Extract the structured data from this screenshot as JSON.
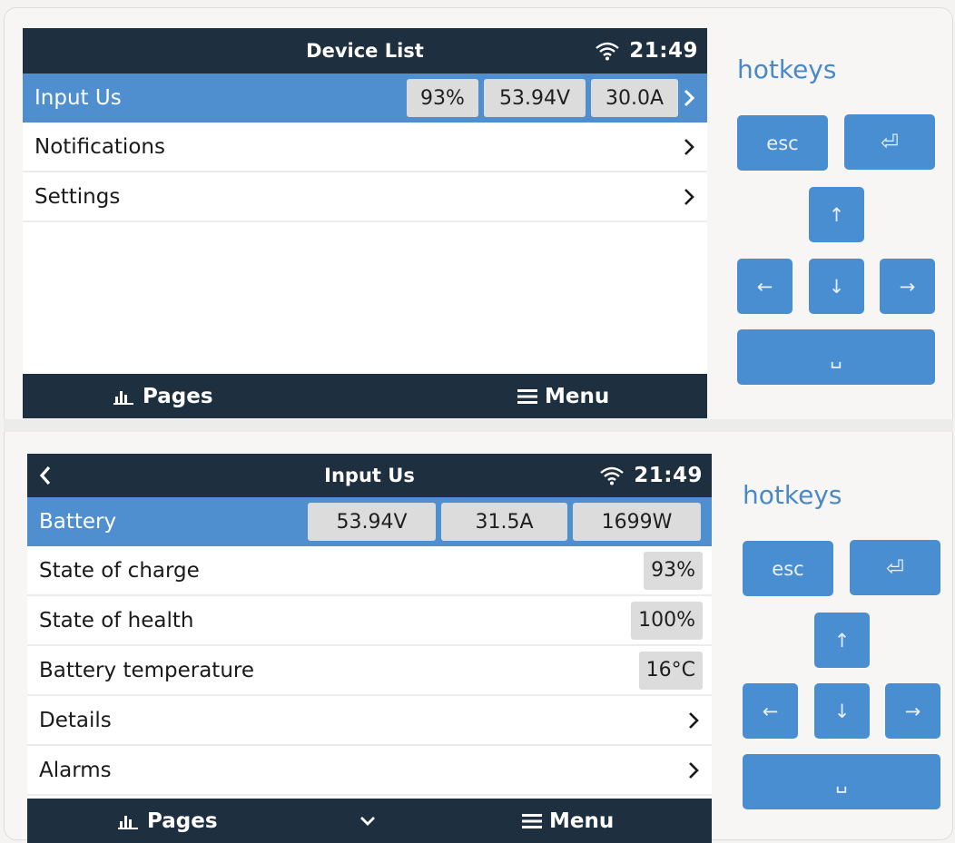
{
  "panel1": {
    "title": "Device List",
    "clock": "21:49",
    "rows": [
      {
        "label": "Input Us",
        "values": [
          "93%",
          "53.94V",
          "30.0A"
        ]
      },
      {
        "label": "Notifications"
      },
      {
        "label": "Settings"
      }
    ],
    "bottom": {
      "pages": "Pages",
      "menu": "Menu"
    }
  },
  "panel2": {
    "title": "Input Us",
    "clock": "21:49",
    "header_row": {
      "label": "Battery",
      "values": [
        "53.94V",
        "31.5A",
        "1699W"
      ]
    },
    "rows": [
      {
        "label": "State of charge",
        "value": "93%"
      },
      {
        "label": "State of health",
        "value": "100%"
      },
      {
        "label": "Battery temperature",
        "value": "16°C"
      },
      {
        "label": "Details"
      },
      {
        "label": "Alarms"
      }
    ],
    "bottom": {
      "pages": "Pages",
      "menu": "Menu"
    }
  },
  "hotkeys": {
    "title": "hotkeys",
    "esc": "esc",
    "enter": "⏎",
    "up": "↑",
    "down": "↓",
    "left": "←",
    "right": "→",
    "space": "␣"
  },
  "colors": {
    "titlebar": "#1e2f40",
    "selected": "#4f8fd0",
    "key": "#4a8ed2"
  }
}
